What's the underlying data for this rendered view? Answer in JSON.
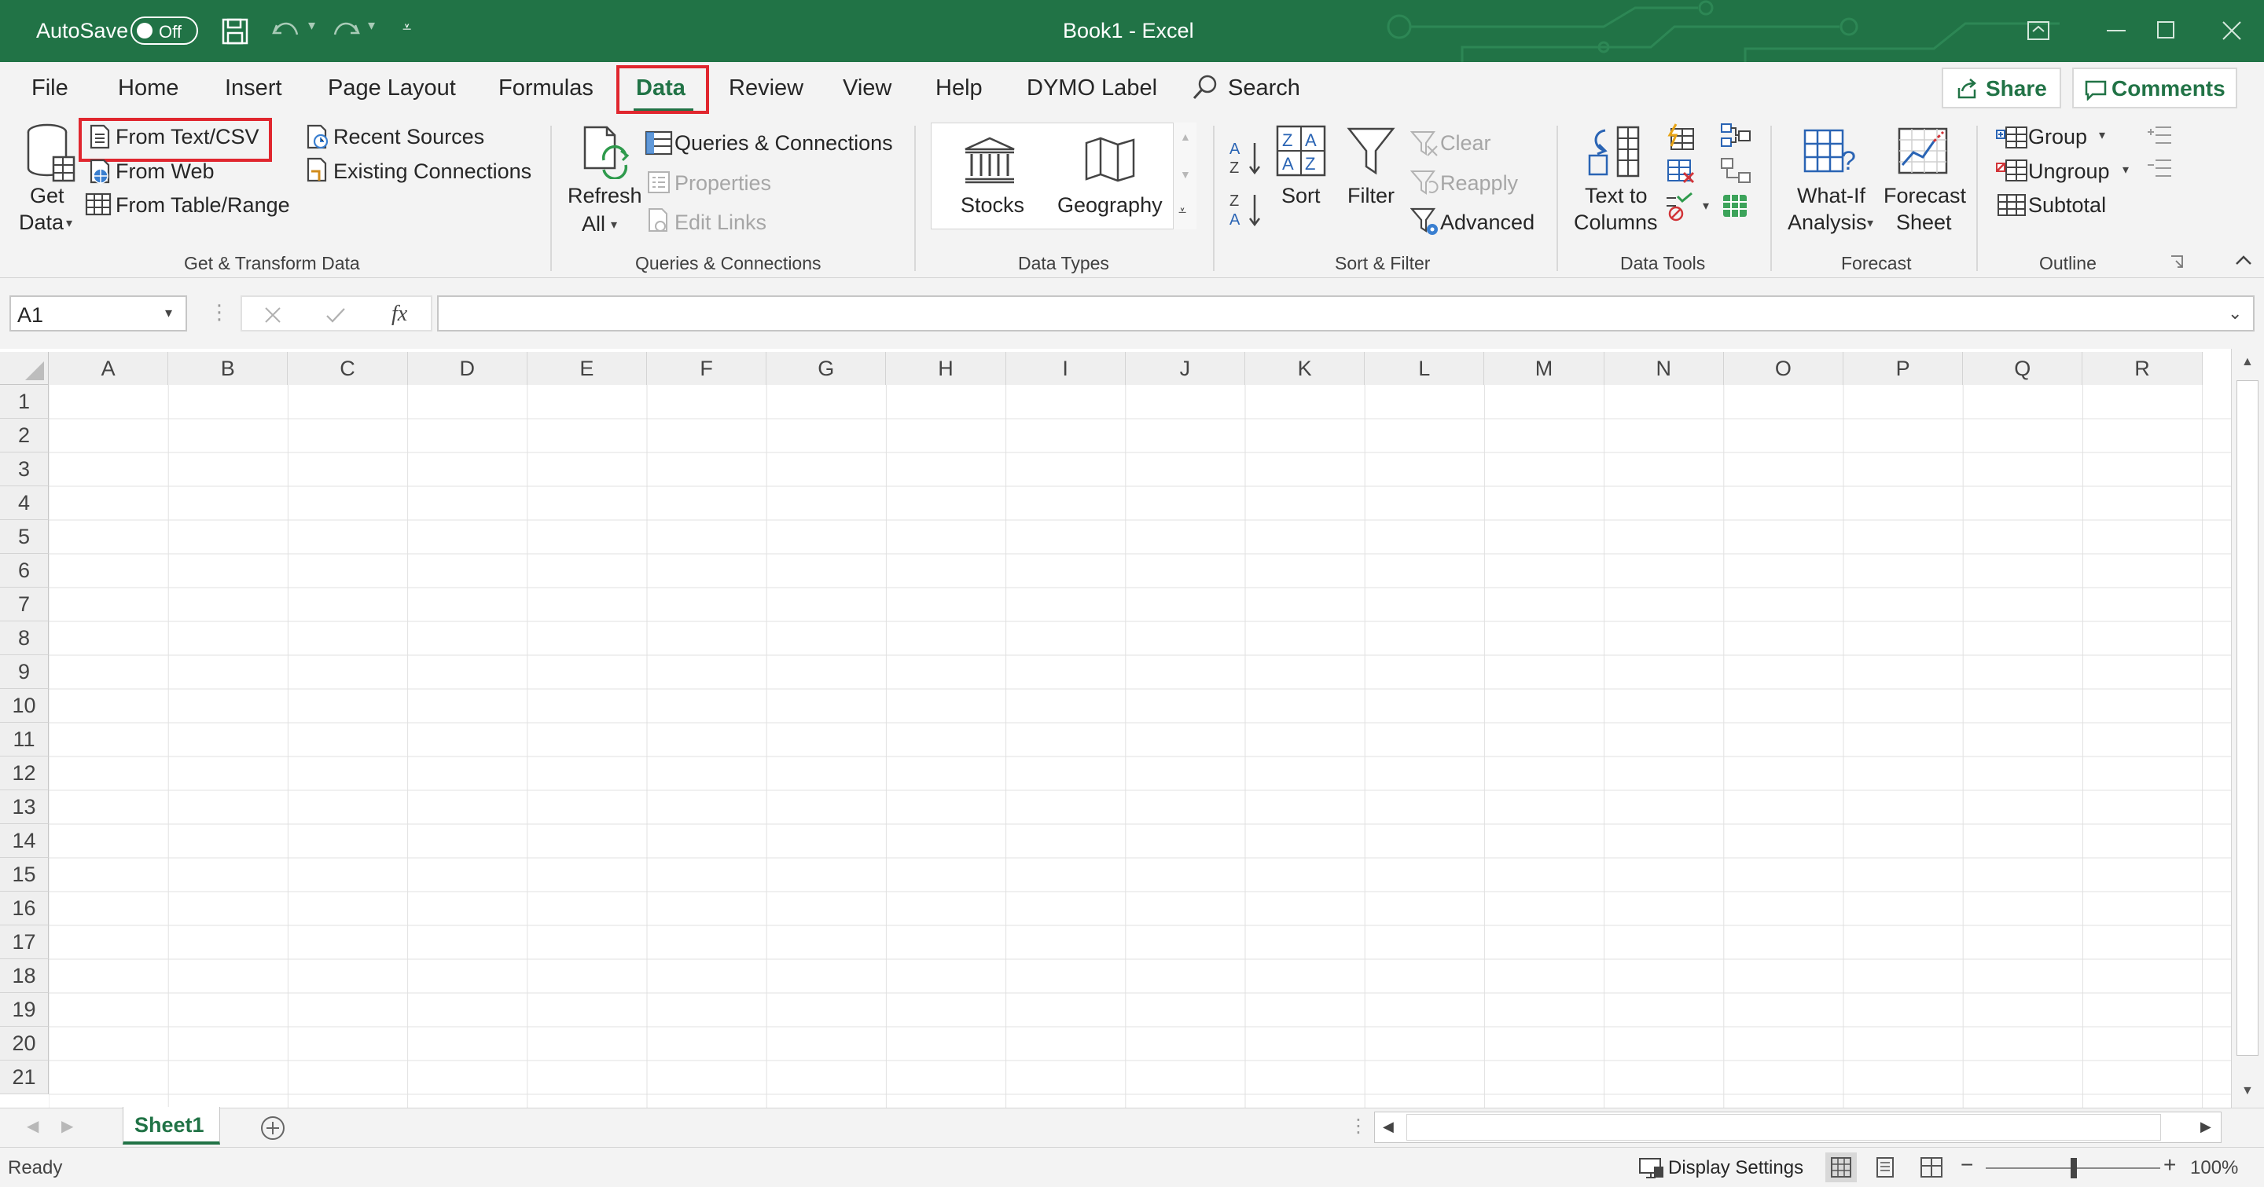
{
  "app": {
    "autosave_label": "AutoSave",
    "autosave_state": "Off",
    "window_title": "Book1  -  Excel",
    "accent_color": "#217346",
    "highlight_color": "#e0262e"
  },
  "tabs": [
    "File",
    "Home",
    "Insert",
    "Page Layout",
    "Formulas",
    "Data",
    "Review",
    "View",
    "Help",
    "DYMO Label"
  ],
  "active_tab": "Data",
  "search_label": "Search",
  "share_label": "Share",
  "comments_label": "Comments",
  "ribbon": {
    "get_transform": {
      "get_data_line1": "Get",
      "get_data_line2": "Data",
      "from_text_csv": "From Text/CSV",
      "from_web": "From Web",
      "from_table_range": "From Table/Range",
      "recent_sources": "Recent Sources",
      "existing_connections": "Existing Connections",
      "group_label": "Get & Transform Data"
    },
    "queries": {
      "refresh_line1": "Refresh",
      "refresh_line2": "All",
      "queries_connections": "Queries & Connections",
      "properties": "Properties",
      "edit_links": "Edit Links",
      "group_label": "Queries & Connections"
    },
    "data_types": {
      "stocks": "Stocks",
      "geography": "Geography",
      "group_label": "Data Types"
    },
    "sort_filter": {
      "sort": "Sort",
      "filter": "Filter",
      "clear": "Clear",
      "reapply": "Reapply",
      "advanced": "Advanced",
      "group_label": "Sort & Filter"
    },
    "data_tools": {
      "text_to_columns_line1": "Text to",
      "text_to_columns_line2": "Columns",
      "group_label": "Data Tools"
    },
    "forecast": {
      "what_if_line1": "What-If",
      "what_if_line2": "Analysis",
      "forecast_sheet_line1": "Forecast",
      "forecast_sheet_line2": "Sheet",
      "group_label": "Forecast"
    },
    "outline": {
      "group": "Group",
      "ungroup": "Ungroup",
      "subtotal": "Subtotal",
      "group_label": "Outline"
    }
  },
  "formula_bar": {
    "name_box": "A1",
    "fx": "fx",
    "value": ""
  },
  "columns": [
    "A",
    "B",
    "C",
    "D",
    "E",
    "F",
    "G",
    "H",
    "I",
    "J",
    "K",
    "L",
    "M",
    "N",
    "O",
    "P",
    "Q",
    "R"
  ],
  "rows": [
    "1",
    "2",
    "3",
    "4",
    "5",
    "6",
    "7",
    "8",
    "9",
    "10",
    "11",
    "12",
    "13",
    "14",
    "15",
    "16",
    "17",
    "18",
    "19",
    "20",
    "21"
  ],
  "sheet_tabs": [
    "Sheet1"
  ],
  "status": {
    "ready": "Ready",
    "display_settings": "Display Settings",
    "zoom": "100%"
  }
}
